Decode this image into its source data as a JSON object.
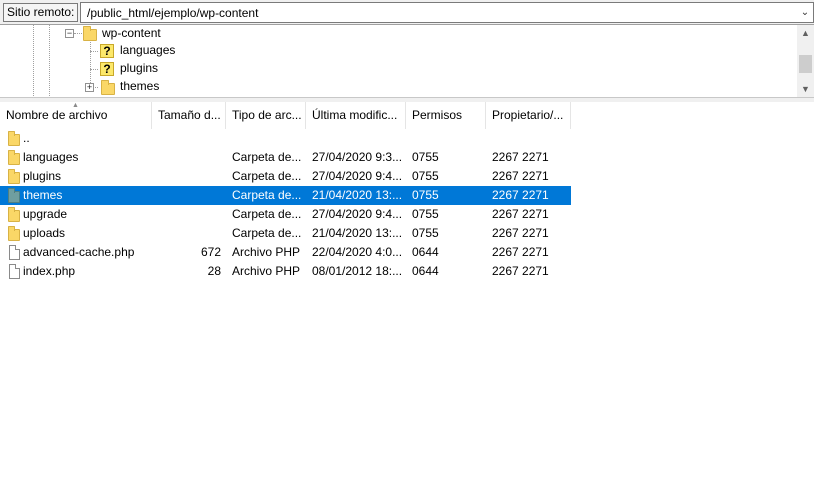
{
  "remote": {
    "label": "Sitio remoto:",
    "path": "/public_html/ejemplo/wp-content"
  },
  "tree": {
    "nodes": [
      {
        "label": "wp-content",
        "icon": "folder-icon",
        "expanded": true
      },
      {
        "label": "languages",
        "icon": "question-folder-icon"
      },
      {
        "label": "plugins",
        "icon": "question-folder-icon"
      },
      {
        "label": "themes",
        "icon": "folder-icon",
        "expandable": true
      }
    ]
  },
  "columns": [
    {
      "label": "Nombre de archivo"
    },
    {
      "label": "Tamaño d..."
    },
    {
      "label": "Tipo de arc..."
    },
    {
      "label": "Última modific..."
    },
    {
      "label": "Permisos"
    },
    {
      "label": "Propietario/..."
    }
  ],
  "files": [
    {
      "name": "..",
      "size": "",
      "type": "",
      "date": "",
      "perm": "",
      "owner": "",
      "icon": "folder-icon"
    },
    {
      "name": "languages",
      "size": "",
      "type": "Carpeta de...",
      "date": "27/04/2020 9:3...",
      "perm": "0755",
      "owner": "2267 2271",
      "icon": "folder-icon"
    },
    {
      "name": "plugins",
      "size": "",
      "type": "Carpeta de...",
      "date": "27/04/2020 9:4...",
      "perm": "0755",
      "owner": "2267 2271",
      "icon": "folder-icon"
    },
    {
      "name": "themes",
      "size": "",
      "type": "Carpeta de...",
      "date": "21/04/2020 13:...",
      "perm": "0755",
      "owner": "2267 2271",
      "icon": "folder-icon",
      "selected": true
    },
    {
      "name": "upgrade",
      "size": "",
      "type": "Carpeta de...",
      "date": "27/04/2020 9:4...",
      "perm": "0755",
      "owner": "2267 2271",
      "icon": "folder-icon"
    },
    {
      "name": "uploads",
      "size": "",
      "type": "Carpeta de...",
      "date": "21/04/2020 13:...",
      "perm": "0755",
      "owner": "2267 2271",
      "icon": "folder-icon"
    },
    {
      "name": "advanced-cache.php",
      "size": "672",
      "type": "Archivo PHP",
      "date": "22/04/2020 4:0...",
      "perm": "0644",
      "owner": "2267 2271",
      "icon": "file-icon"
    },
    {
      "name": "index.php",
      "size": "28",
      "type": "Archivo PHP",
      "date": "08/01/2012 18:...",
      "perm": "0644",
      "owner": "2267 2271",
      "icon": "file-icon"
    }
  ],
  "colors": {
    "selection": "#0078d7",
    "folder": "#fad767"
  }
}
